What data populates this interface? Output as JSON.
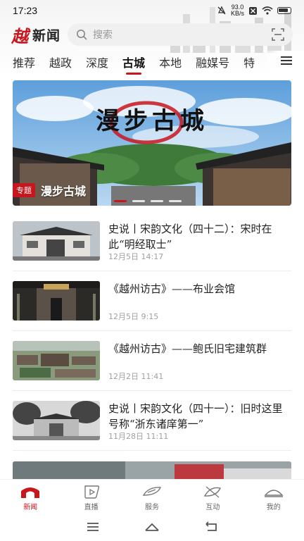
{
  "status_bar": {
    "time": "17:23",
    "net_speed_value": "93.0",
    "net_speed_unit": "KB/s"
  },
  "header": {
    "logo_mark": "越",
    "logo_text": "新闻",
    "search_placeholder": "搜索"
  },
  "tabs": [
    {
      "label": "推荐",
      "active": false
    },
    {
      "label": "越政",
      "active": false
    },
    {
      "label": "深度",
      "active": false
    },
    {
      "label": "古城",
      "active": true
    },
    {
      "label": "本地",
      "active": false
    },
    {
      "label": "融媒号",
      "active": false
    },
    {
      "label": "特",
      "active": false
    }
  ],
  "banner": {
    "title": "漫步古城",
    "tag": "专题",
    "caption": "漫步古城",
    "slide_count": 4,
    "active_slide": 1
  },
  "news": [
    {
      "title": "史说丨宋韵文化（四十二）：宋时在此“明经取士”",
      "time": "12月5日  14:17"
    },
    {
      "title": "《越州访古》——布业会馆",
      "time": "12月5日  9:15"
    },
    {
      "title": "《越州访古》——鲍氏旧宅建筑群",
      "time": "12月2日  11:41"
    },
    {
      "title": "史说丨宋韵文化（四十一）：旧时这里号称“浙东诸庠第一”",
      "time": "11月28日  11:11"
    }
  ],
  "bottom_nav": [
    {
      "label": "新闻",
      "icon": "news-gate-icon",
      "active": true
    },
    {
      "label": "直播",
      "icon": "live-play-icon",
      "active": false
    },
    {
      "label": "服务",
      "icon": "service-icon",
      "active": false
    },
    {
      "label": "互动",
      "icon": "interact-icon",
      "active": false
    },
    {
      "label": "我的",
      "icon": "profile-hat-icon",
      "active": false
    }
  ],
  "colors": {
    "accent": "#c8161d",
    "text": "#222222",
    "muted": "#a0a0a0"
  }
}
